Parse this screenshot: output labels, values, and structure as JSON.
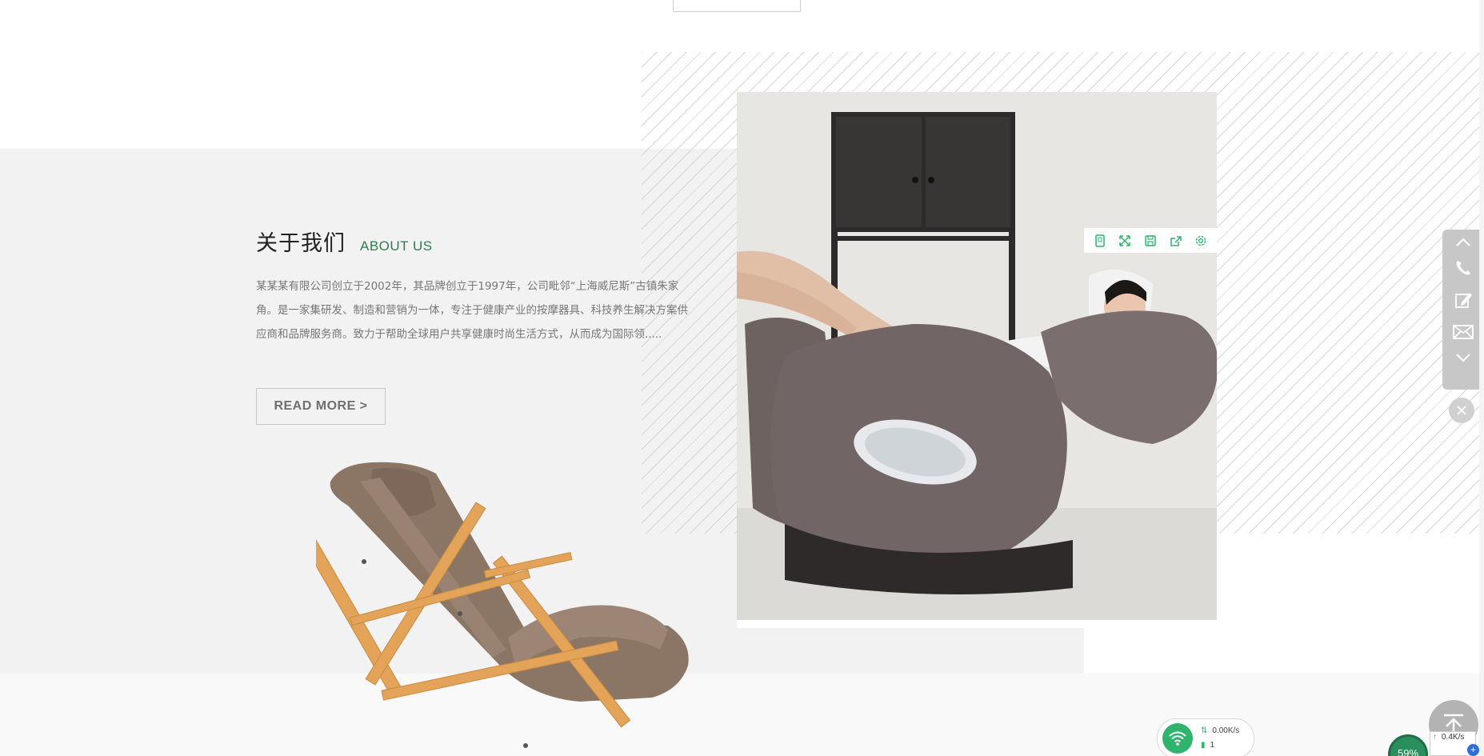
{
  "about": {
    "title_cn": "关于我们",
    "title_en": "ABOUT US",
    "description": "某某某有限公司创立于2002年，其品牌创立于1997年，公司毗邻“上海威尼斯”古镇朱家角。是一家集研发、制造和营销为一体，专注于健康产业的按摩器具、科技养生解决方案供应商和品牌服务商。致力于帮助全球用户共享健康时尚生活方式，从而成为国际领.....",
    "read_more": "READ MORE >"
  },
  "image_toolbar": {
    "icons": [
      "tablet-icon",
      "expand-icon",
      "save-icon",
      "share-icon",
      "settings-icon"
    ]
  },
  "side_contact": {
    "icons": [
      "chevron-up-icon",
      "phone-icon",
      "edit-icon",
      "mail-icon",
      "chevron-down-icon"
    ],
    "close_icon": "close-icon"
  },
  "back_to_top": {
    "icon": "arrow-up-icon"
  },
  "network_widget": {
    "speed": "0.00K/s",
    "count": "1"
  },
  "system_tray": {
    "percent": "59%",
    "speed": "0.4K/s",
    "plus": "+"
  },
  "colors": {
    "accent_green": "#2e7d4f",
    "panel_gray": "#f2f2f2",
    "toolbar_green": "#2fb46e"
  }
}
